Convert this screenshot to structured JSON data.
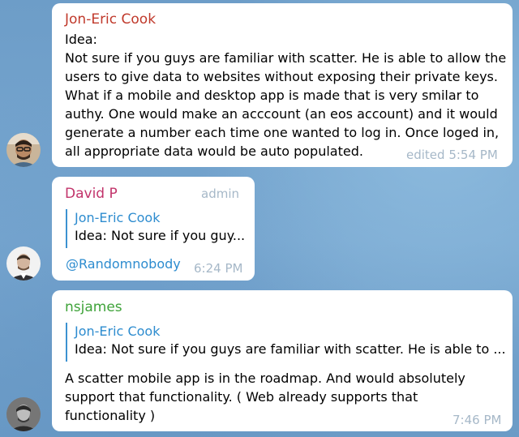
{
  "messages": [
    {
      "sender": "Jon-Eric Cook",
      "sender_color": "#c0392b",
      "lines": [
        "Idea:",
        "Not sure if you guys are familiar with scatter. He is able to allow the",
        "users to give data to websites without exposing their private keys.",
        "What if a mobile and desktop app is made that is very smilar to",
        "authy. One would make an acccount (an eos account) and it would",
        "generate a number each time one wanted to log in. Once loged in,",
        "all appropriate data would be auto populated."
      ],
      "time": "edited 5:54 PM"
    },
    {
      "sender": "David P",
      "sender_color": "#c2346b",
      "badge": "admin",
      "reply": {
        "name": "Jon-Eric Cook",
        "text": "Idea: Not sure if you guy..."
      },
      "mention": "@Randomnobody",
      "time": "6:24 PM"
    },
    {
      "sender": "nsjames",
      "sender_color": "#3fa33a",
      "reply": {
        "name": "Jon-Eric Cook",
        "text": "Idea: Not sure if you guys are familiar with scatter. He is able to ..."
      },
      "lines": [
        "A scatter mobile app is in the roadmap. And would absolutely",
        "support that functionality. ( Web already supports that",
        "functionality )"
      ],
      "time": "7:46 PM"
    }
  ]
}
